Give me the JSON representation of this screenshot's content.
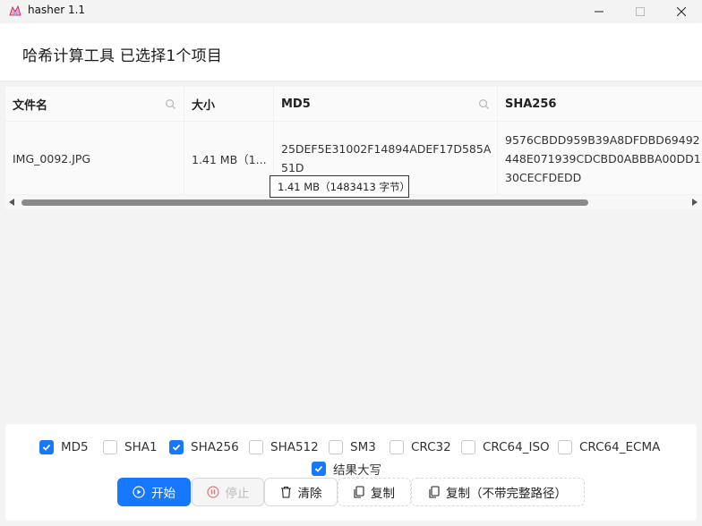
{
  "window": {
    "title": "hasher 1.1",
    "minimize": "—",
    "maximize": "☐",
    "close": "✕"
  },
  "header": {
    "title": "哈希计算工具 已选择1个项目"
  },
  "table": {
    "columns": [
      "文件名",
      "大小",
      "MD5",
      "SHA256"
    ],
    "rows": [
      {
        "name": "IMG_0092.JPG",
        "size": "1.41 MB（1...",
        "md5": "25DEF5E31002F14894ADEF17D585A51D",
        "sha256": "9576CBDD959B39A8DFDBD69492448E071939CDCBD0ABBBA00DD130CECFDEDD"
      }
    ],
    "tooltip": "1.41 MB（1483413 字节）"
  },
  "options": {
    "algorithms": [
      {
        "label": "MD5",
        "checked": true
      },
      {
        "label": "SHA1",
        "checked": false
      },
      {
        "label": "SHA256",
        "checked": true
      },
      {
        "label": "SHA512",
        "checked": false
      },
      {
        "label": "SM3",
        "checked": false
      },
      {
        "label": "CRC32",
        "checked": false
      },
      {
        "label": "CRC64_ISO",
        "checked": false
      },
      {
        "label": "CRC64_ECMA",
        "checked": false
      }
    ],
    "uppercase": {
      "label": "结果大写",
      "checked": true
    }
  },
  "actions": {
    "start": "开始",
    "stop": "停止",
    "clear": "清除",
    "copy": "复制",
    "copy_no_path": "复制（不带完整路径）"
  },
  "colors": {
    "accent": "#1677ff",
    "stop_icon": "#e57373"
  }
}
